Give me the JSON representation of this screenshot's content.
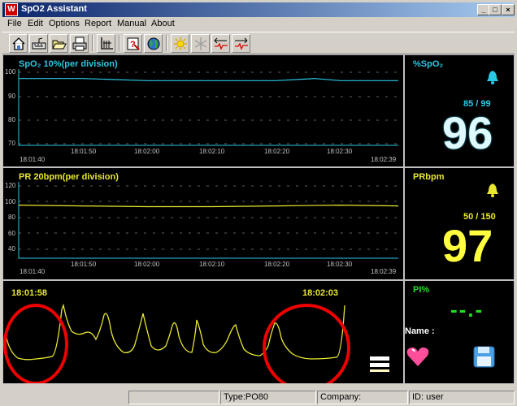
{
  "window": {
    "title": "SpO2 Assistant",
    "app_icon": "W"
  },
  "caption_buttons": {
    "minimize": "_",
    "maximize": "□",
    "close": "×"
  },
  "menu": [
    "File",
    "Edit",
    "Options",
    "Report",
    "Manual",
    "About"
  ],
  "toolbar_icons": [
    "home-icon",
    "keyboard-icon",
    "open-folder-icon",
    "print-icon",
    "chart-icon",
    "question-icon",
    "globe-icon",
    "sun-icon",
    "snowflake-icon",
    "arrow-left-wave-icon",
    "arrow-right-wave-icon"
  ],
  "spo2_chart": {
    "title": "SpO₂    10%(per division)",
    "y_ticks": [
      "100",
      "90",
      "80",
      "70"
    ],
    "x_start": "18:01:40",
    "x_ticks": [
      "18:01:50",
      "18:02:00",
      "18:02:10",
      "18:02:20",
      "18:02:30"
    ],
    "x_end": "18:02:39",
    "color": "#2bc8e6"
  },
  "pr_chart": {
    "title": "PR    20bpm(per division)",
    "y_ticks": [
      "120",
      "100",
      "80",
      "60",
      "40"
    ],
    "x_start": "18:01:40",
    "x_ticks": [
      "18:01:50",
      "18:02:00",
      "18:02:10",
      "18:02:20",
      "18:02:30"
    ],
    "x_end": "18:02:39",
    "color": "#e8e830"
  },
  "spo2_panel": {
    "label": "%SpO₂",
    "limits": "85 / 99",
    "value": "96"
  },
  "pr_panel": {
    "label": "PRbpm",
    "limits": "50 / 150",
    "value": "97"
  },
  "pleth": {
    "time_left": "18:01:58",
    "time_right": "18:02:03"
  },
  "pi_panel": {
    "label": "PI%",
    "value": "--.-",
    "name_label": "Name :"
  },
  "status": {
    "type": "Type:PO80",
    "company": "Company:",
    "id": "ID:  user"
  },
  "chart_data": [
    {
      "type": "line",
      "title": "SpO₂ 10%(per division)",
      "xlabel": "",
      "ylabel": "",
      "ylim": [
        65,
        100
      ],
      "x": [
        "18:01:40",
        "18:01:50",
        "18:02:00",
        "18:02:10",
        "18:02:20",
        "18:02:26",
        "18:02:30",
        "18:02:32",
        "18:02:39"
      ],
      "series": [
        {
          "values": [
            97,
            97,
            96,
            96,
            96,
            97,
            96,
            96,
            96
          ]
        }
      ]
    },
    {
      "type": "line",
      "title": "PR 20bpm(per division)",
      "xlabel": "",
      "ylabel": "",
      "ylim": [
        30,
        125
      ],
      "x": [
        "18:01:40",
        "18:01:50",
        "18:02:00",
        "18:02:10",
        "18:02:20",
        "18:02:30",
        "18:02:39"
      ],
      "series": [
        {
          "values": [
            99,
            98,
            97,
            97,
            98,
            99,
            98
          ]
        }
      ]
    }
  ]
}
